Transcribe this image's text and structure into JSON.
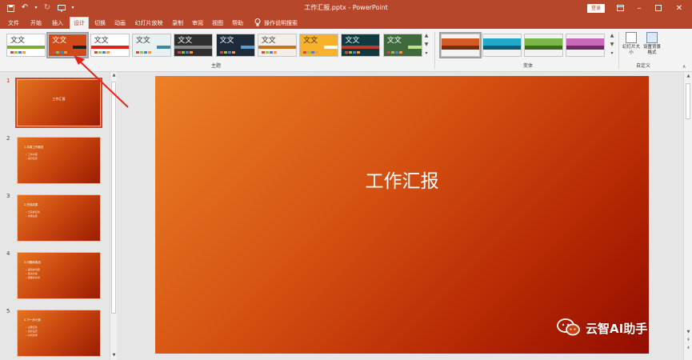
{
  "window": {
    "title": "工作汇报.pptx - PowerPoint",
    "login_label": "登录",
    "ribbon_display_icon": "ribbon-display-icon",
    "minimize_icon": "minimize-icon",
    "maximize_icon": "maximize-icon",
    "close_icon": "close-icon"
  },
  "qat": {
    "items": [
      "save-icon",
      "undo-icon",
      "redo-icon",
      "start-presentation-icon",
      "customize-qat-icon"
    ]
  },
  "tabs": [
    {
      "label": "文件"
    },
    {
      "label": "开始"
    },
    {
      "label": "插入"
    },
    {
      "label": "设计",
      "active": true
    },
    {
      "label": "切换"
    },
    {
      "label": "动画"
    },
    {
      "label": "幻灯片放映"
    },
    {
      "label": "录制"
    },
    {
      "label": "审阅"
    },
    {
      "label": "视图"
    },
    {
      "label": "帮助"
    }
  ],
  "tell_me": {
    "label": "操作说明搜索",
    "icon": "lightbulb-icon"
  },
  "ribbon": {
    "themes_label": "主题",
    "variants_label": "变体",
    "customize_label": "自定义",
    "theme_thumb_text": "文文",
    "theme_thumb_text_first": "文文",
    "slide_size_label": "幻灯片大小",
    "format_bg_label": "设置背景格式",
    "themes": [
      {
        "bg": "#ffffff",
        "fg": "#333333",
        "accent": "#7aab3c"
      },
      {
        "bg": "#d04a18",
        "fg": "#ffffff",
        "accent": "#1f1f1f"
      },
      {
        "bg": "#ffffff",
        "fg": "#333333",
        "accent": "#e2231a"
      },
      {
        "bg": "#e8f1f2",
        "fg": "#333333",
        "accent": "#3d8a9c"
      },
      {
        "bg": "#2f2f2f",
        "fg": "#ffffff",
        "accent": "#888888"
      },
      {
        "bg": "#1e2b3a",
        "fg": "#ffffff",
        "accent": "#5b9bd5"
      },
      {
        "bg": "#f4efe6",
        "fg": "#333333",
        "accent": "#c8731f"
      },
      {
        "bg": "#f7b12b",
        "fg": "#333333",
        "accent": "#ffffff"
      },
      {
        "bg": "#0f3a40",
        "fg": "#ffffff",
        "accent": "#c0392b"
      },
      {
        "bg": "#3f6b3c",
        "fg": "#ffffff",
        "accent": "#bfe08a"
      }
    ],
    "variants": [
      {
        "bg": "#d35a22",
        "accent": "#7a2a0d"
      },
      {
        "bg": "#22a9c9",
        "accent": "#0f5e75"
      },
      {
        "bg": "#7ab648",
        "accent": "#3d6b20"
      },
      {
        "bg": "#c86ab9",
        "accent": "#6b2b63"
      }
    ]
  },
  "slides": [
    {
      "num": "1",
      "title": "工作汇报",
      "bullets": []
    },
    {
      "num": "2",
      "title": "1.本周工作概述",
      "bullets": [
        "• 工作内容",
        "• 进行任务"
      ]
    },
    {
      "num": "3",
      "title": "2.完成成果",
      "bullets": [
        "• 已完成任务",
        "• 成果总结"
      ]
    },
    {
      "num": "4",
      "title": "3.问题和挑战",
      "bullets": [
        "• 遇到的问题",
        "• 解决方案",
        "• 需要的支持"
      ]
    },
    {
      "num": "5",
      "title": "4.下一步计划",
      "bullets": [
        "• 主要任务",
        "• 目标设定",
        "• 时间安排"
      ]
    }
  ],
  "main_slide": {
    "title": "工作汇报"
  },
  "watermark": {
    "text": "云智AI助手",
    "icon": "wechat-icon"
  },
  "colors": {
    "accent": "#b7472a",
    "slide_from": "#ec8027",
    "slide_to": "#930d00"
  }
}
